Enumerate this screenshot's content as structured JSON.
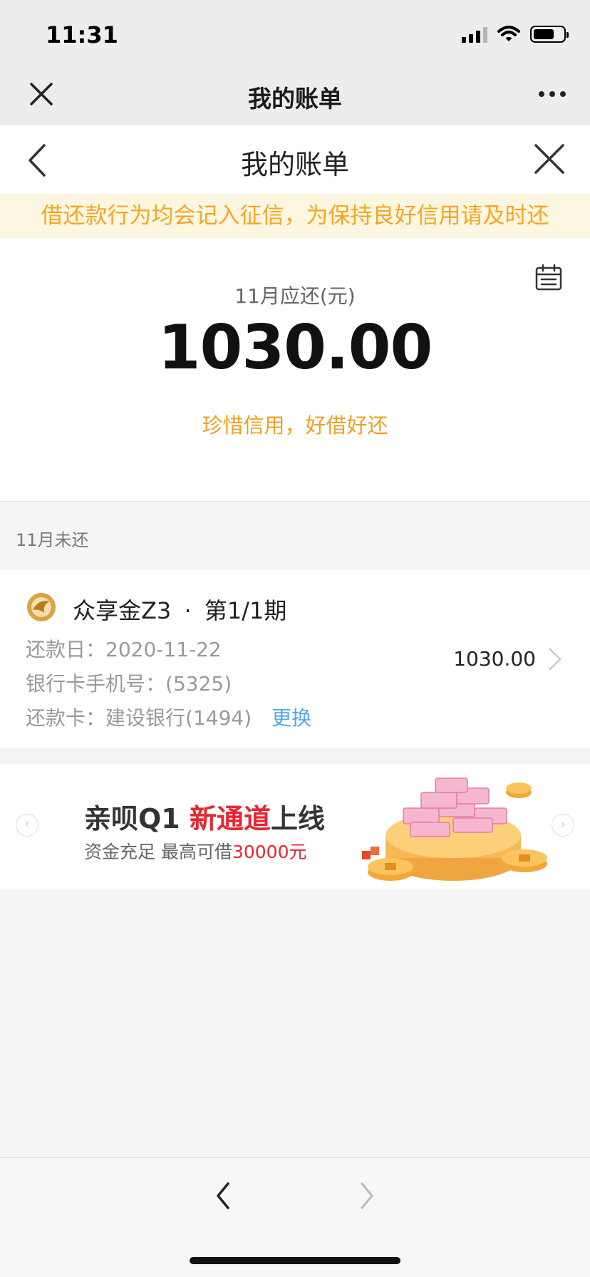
{
  "status_bar": {
    "time": "11:31"
  },
  "wechat_bar": {
    "title": "我的账单"
  },
  "header": {
    "title": "我的账单"
  },
  "notice": {
    "text": "借还款行为均会记入征信，为保持良好信用请及时还"
  },
  "summary": {
    "due_label": "11月应还(元)",
    "due_amount": "1030.00",
    "slogan": "珍惜信用，好借好还"
  },
  "section": {
    "title": "11月未还"
  },
  "bill": {
    "product": "众享金Z3",
    "separator": "·",
    "period": "第1/1期",
    "due_date_label": "还款日：",
    "due_date": "2020-11-22",
    "phone_label": "银行卡手机号：",
    "phone": "(5325)",
    "card_label": "还款卡：",
    "card": "建设银行(1494)",
    "change_label": "更换",
    "amount": "1030.00"
  },
  "banner": {
    "title_part1": "亲呗Q1 ",
    "title_highlight": "新通道",
    "title_part2": "上线",
    "sub_part1": "资金充足 最高可借",
    "sub_amount": "30000元",
    "colors": {
      "highlight": "#e8262f"
    }
  },
  "icons": {
    "wechat_close": "close-icon",
    "wechat_more": "more-icon",
    "back": "chevron-left-icon",
    "close": "close-icon",
    "calendar": "calendar-icon",
    "logo": "brand-logo",
    "chevron": "chevron-right-icon"
  },
  "colors": {
    "notice_text": "#f5a623",
    "notice_bg": "#fef6e0",
    "slogan": "#f0a020",
    "link": "#4fa8e8"
  }
}
